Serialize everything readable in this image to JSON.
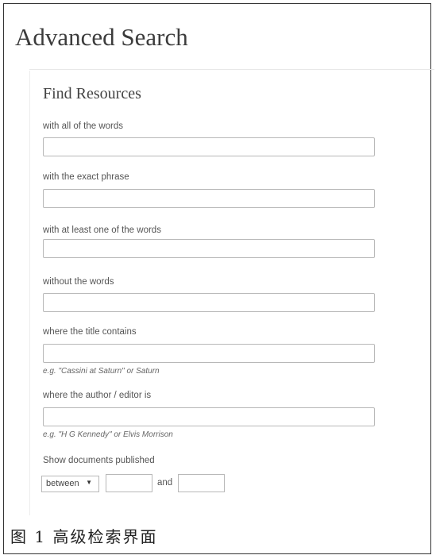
{
  "page": {
    "title": "Advanced Search"
  },
  "panel": {
    "title": "Find Resources",
    "fields": [
      {
        "label": "with all of the words",
        "value": ""
      },
      {
        "label": "with the exact phrase",
        "value": ""
      },
      {
        "label": "with at least one of the words",
        "value": ""
      },
      {
        "label": "without the words",
        "value": ""
      },
      {
        "label": "where the title contains",
        "value": "",
        "hint": "e.g. \"Cassini at Saturn\" or Saturn"
      },
      {
        "label": "where the author / editor is",
        "value": "",
        "hint": "e.g. \"H G Kennedy\" or Elvis Morrison"
      }
    ],
    "published": {
      "label": "Show documents published",
      "mode": "between",
      "from": "",
      "to": "",
      "and_label": "and"
    }
  },
  "caption": "图 1  高级检索界面"
}
